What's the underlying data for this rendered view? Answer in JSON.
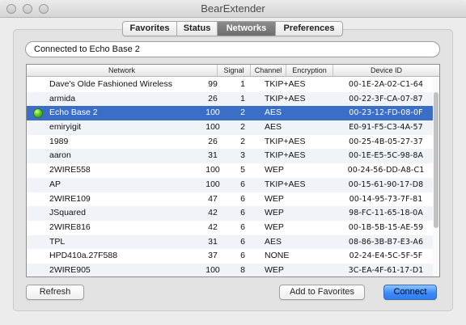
{
  "window": {
    "title": "BearExtender"
  },
  "tabs": [
    {
      "label": "Favorites",
      "active": false
    },
    {
      "label": "Status",
      "active": false
    },
    {
      "label": "Networks",
      "active": true
    },
    {
      "label": "Preferences",
      "active": false
    }
  ],
  "status_text": "Connected to Echo Base 2",
  "table": {
    "columns": [
      "Network",
      "Signal",
      "Channel",
      "Encryption",
      "Device ID"
    ],
    "rows": [
      {
        "network": "Dave's Olde Fashioned Wireless",
        "signal": "99",
        "channel": "1",
        "encryption": "TKIP+AES",
        "device_id": "00-1E-2A-02-C1-64",
        "connected": false,
        "selected": false
      },
      {
        "network": "armida",
        "signal": "26",
        "channel": "1",
        "encryption": "TKIP+AES",
        "device_id": "00-22-3F-CA-07-87",
        "connected": false,
        "selected": false
      },
      {
        "network": "Echo Base 2",
        "signal": "100",
        "channel": "2",
        "encryption": "AES",
        "device_id": "00-23-12-FD-08-0F",
        "connected": true,
        "selected": true
      },
      {
        "network": "emiryigit",
        "signal": "100",
        "channel": "2",
        "encryption": "AES",
        "device_id": "E0-91-F5-C3-4A-57",
        "connected": false,
        "selected": false
      },
      {
        "network": "1989",
        "signal": "26",
        "channel": "2",
        "encryption": "TKIP+AES",
        "device_id": "00-25-4B-05-27-37",
        "connected": false,
        "selected": false
      },
      {
        "network": "aaron",
        "signal": "31",
        "channel": "3",
        "encryption": "TKIP+AES",
        "device_id": "00-1E-E5-5C-98-8A",
        "connected": false,
        "selected": false
      },
      {
        "network": "2WIRE558",
        "signal": "100",
        "channel": "5",
        "encryption": "WEP",
        "device_id": "00-24-56-DD-A8-C1",
        "connected": false,
        "selected": false
      },
      {
        "network": "AP",
        "signal": "100",
        "channel": "6",
        "encryption": "TKIP+AES",
        "device_id": "00-15-61-90-17-D8",
        "connected": false,
        "selected": false
      },
      {
        "network": "2WIRE109",
        "signal": "47",
        "channel": "6",
        "encryption": "WEP",
        "device_id": "00-14-95-73-7F-81",
        "connected": false,
        "selected": false
      },
      {
        "network": "JSquared",
        "signal": "42",
        "channel": "6",
        "encryption": "WEP",
        "device_id": "98-FC-11-65-18-0A",
        "connected": false,
        "selected": false
      },
      {
        "network": "2WIRE816",
        "signal": "42",
        "channel": "6",
        "encryption": "WEP",
        "device_id": "00-1B-5B-15-AE-59",
        "connected": false,
        "selected": false
      },
      {
        "network": "TPL",
        "signal": "31",
        "channel": "6",
        "encryption": "AES",
        "device_id": "08-86-3B-B7-E3-A6",
        "connected": false,
        "selected": false
      },
      {
        "network": "HPD410a.27F588",
        "signal": "37",
        "channel": "6",
        "encryption": "NONE",
        "device_id": "02-24-E4-5C-5F-5F",
        "connected": false,
        "selected": false
      },
      {
        "network": "2WIRE905",
        "signal": "100",
        "channel": "8",
        "encryption": "WEP",
        "device_id": "3C-EA-4F-61-17-D1",
        "connected": false,
        "selected": false
      }
    ]
  },
  "buttons": {
    "refresh": "Refresh",
    "add_favorites": "Add to Favorites",
    "connect": "Connect"
  },
  "colors": {
    "selection": "#3a6ec7",
    "connected_indicator": "#4cbf1f",
    "connect_button": "#3d8af7"
  }
}
